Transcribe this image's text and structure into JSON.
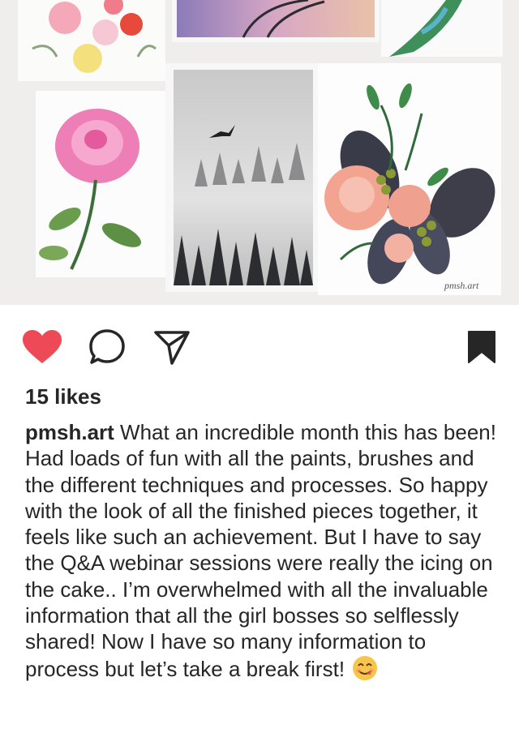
{
  "post": {
    "image_alt": "Watercolor paintings collage",
    "watermark": "pmsh.art"
  },
  "actions": {
    "like": "heart-icon",
    "comment": "comment-icon",
    "share": "send-icon",
    "save": "bookmark-icon",
    "liked": true,
    "saved": true,
    "like_color": "#ed4956"
  },
  "likes": "15 likes",
  "caption": {
    "username": "pmsh.art",
    "text": "What an incredible month this has been! Had loads of fun with all the paints, brushes and the different techniques and processes. So happy with the look of all the finished pieces together, it feels like such an achievement. But I have to say the Q&A webinar sessions were really the icing on the cake.. I’m  overwhelmed with all the invaluable information that all the girl bosses so selflessly shared! Now I have so many information to process but let’s take a break first!",
    "emoji": "😋"
  }
}
